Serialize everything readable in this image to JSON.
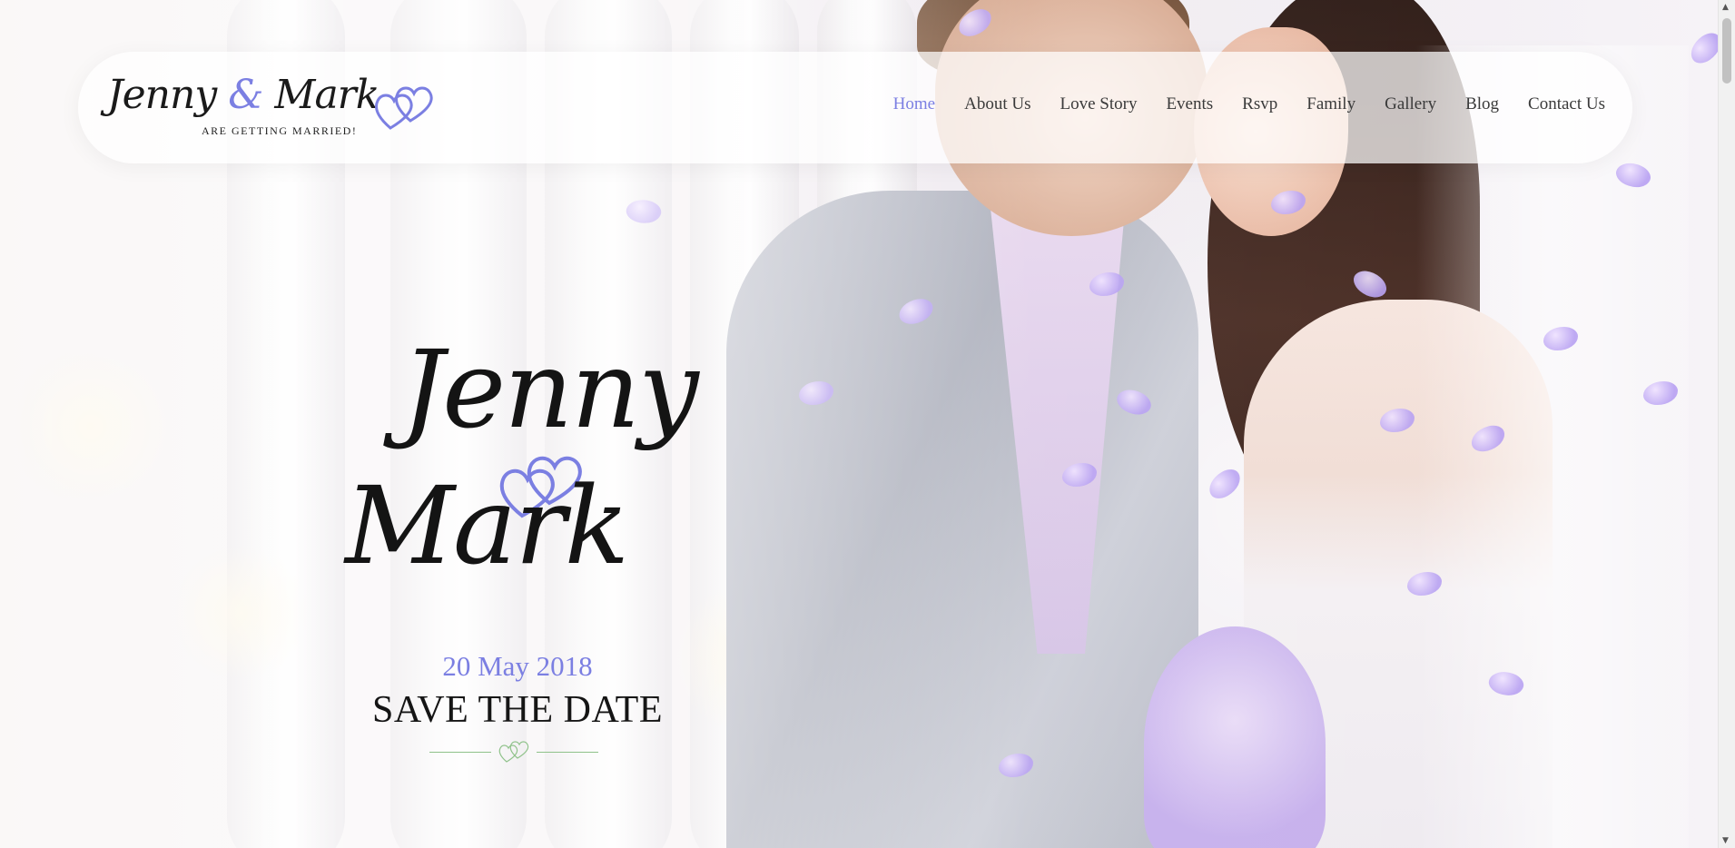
{
  "logo": {
    "name_first": "Jenny",
    "ampersand": "&",
    "name_second": "Mark",
    "tagline": "ARE GETTING MARRIED!"
  },
  "nav": {
    "home": "Home",
    "about": "About Us",
    "love_story": "Love Story",
    "events": "Events",
    "rsvp": "Rsvp",
    "family": "Family",
    "gallery": "Gallery",
    "blog": "Blog",
    "contact": "Contact Us",
    "active": "Home"
  },
  "hero": {
    "name_1": "Jenny",
    "name_2": "Mark",
    "date": "20 May 2018",
    "tagline": "SAVE THE DATE"
  },
  "colors": {
    "accent": "#7b7fe2",
    "text": "#151515",
    "divider": "#8fc28a"
  },
  "icons": {
    "logo_hearts": "double-heart-icon",
    "hero_hearts": "double-heart-icon",
    "divider_hearts": "double-heart-icon",
    "scroll_up": "▲",
    "scroll_down": "▼"
  }
}
